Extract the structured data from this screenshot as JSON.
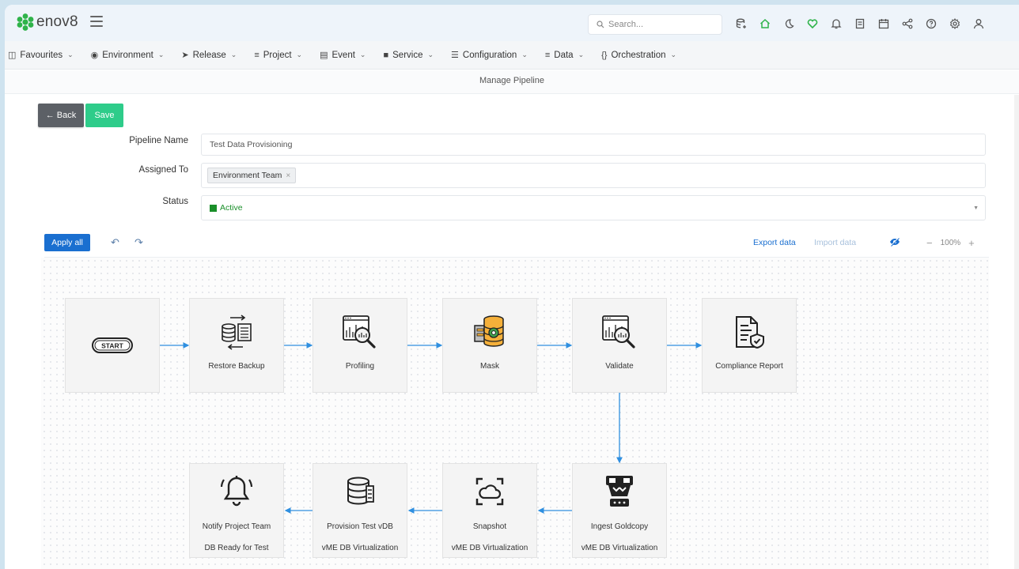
{
  "app": {
    "logo_text": "enov8"
  },
  "search": {
    "placeholder": "Search..."
  },
  "top_icons": [
    "database-plus-icon",
    "home-icon",
    "moon-icon",
    "heart-icon",
    "bell-icon",
    "document-icon",
    "calendar-icon",
    "share-icon",
    "help-icon",
    "gear-icon",
    "user-icon"
  ],
  "menu": [
    {
      "label": "Favourites",
      "icon": "bookmark-icon"
    },
    {
      "label": "Environment",
      "icon": "globe-icon"
    },
    {
      "label": "Release",
      "icon": "rocket-icon"
    },
    {
      "label": "Project",
      "icon": "layers-icon"
    },
    {
      "label": "Event",
      "icon": "calendar-icon"
    },
    {
      "label": "Service",
      "icon": "ticket-icon"
    },
    {
      "label": "Configuration",
      "icon": "bars-icon"
    },
    {
      "label": "Data",
      "icon": "database-icon"
    },
    {
      "label": "Orchestration",
      "icon": "braces-icon"
    }
  ],
  "page": {
    "title": "Manage Pipeline"
  },
  "actions": {
    "back_label": "Back",
    "save_label": "Save"
  },
  "form": {
    "pipeline_name_label": "Pipeline Name",
    "pipeline_name_value": "Test Data Provisioning",
    "assigned_to_label": "Assigned To",
    "assigned_tag": "Environment Team",
    "status_label": "Status",
    "status_value": "Active",
    "status_color": "#1a8f2a"
  },
  "toolbar": {
    "apply_label": "Apply all",
    "export_label": "Export data",
    "import_label": "Import data",
    "zoom_value": "100%"
  },
  "pipeline": {
    "nodes": [
      {
        "id": "start",
        "label": "START",
        "sub": ""
      },
      {
        "id": "restore",
        "label": "Restore Backup",
        "sub": ""
      },
      {
        "id": "profiling",
        "label": "Profiling",
        "sub": ""
      },
      {
        "id": "mask",
        "label": "Mask",
        "sub": ""
      },
      {
        "id": "validate",
        "label": "Validate",
        "sub": ""
      },
      {
        "id": "compliance",
        "label": "Compliance Report",
        "sub": ""
      },
      {
        "id": "ingest",
        "label": "Ingest Goldcopy",
        "sub": "vME DB Virtualization"
      },
      {
        "id": "snapshot",
        "label": "Snapshot",
        "sub": "vME DB Virtualization"
      },
      {
        "id": "provision",
        "label": "Provision Test vDB",
        "sub": "vME DB Virtualization"
      },
      {
        "id": "notify",
        "label": "Notify Project Team",
        "sub": "DB Ready for Test"
      }
    ]
  },
  "colors": {
    "accent": "#1a6fd0",
    "save": "#2ecc8a",
    "arrow": "#2f8fe0"
  }
}
